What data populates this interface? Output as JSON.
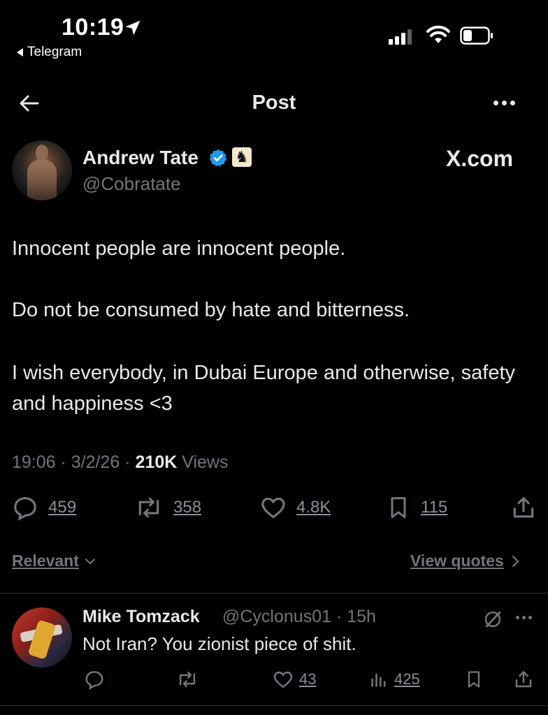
{
  "status_bar": {
    "time": "10:19",
    "back_app": "Telegram"
  },
  "header": {
    "title": "Post"
  },
  "post": {
    "author_name": "Andrew Tate",
    "author_handle": "@Cobratate",
    "source_label": "X.com",
    "paragraphs": [
      "Innocent people are innocent people.",
      "Do not be consumed by hate and bitterness.",
      "I wish everybody, in Dubai Europe and otherwise, safety and happiness <3"
    ],
    "time": "19:06",
    "date": "3/2/26",
    "views_count": "210K",
    "views_label": "Views",
    "replies": "459",
    "reposts": "358",
    "likes": "4.8K",
    "bookmarks": "115"
  },
  "replies_section": {
    "sort_label": "Relevant",
    "view_quotes_label": "View quotes"
  },
  "reply": {
    "name": "Mike Tomzack",
    "handle": "@Cyclonus01",
    "age": "15h",
    "text": "Not Iran?  You zionist piece of shit.",
    "likes": "43",
    "views": "425"
  },
  "colors": {
    "background": "#000000",
    "text": "#e7e9ea",
    "secondary": "#71767b",
    "verified": "#1d9bf0"
  }
}
